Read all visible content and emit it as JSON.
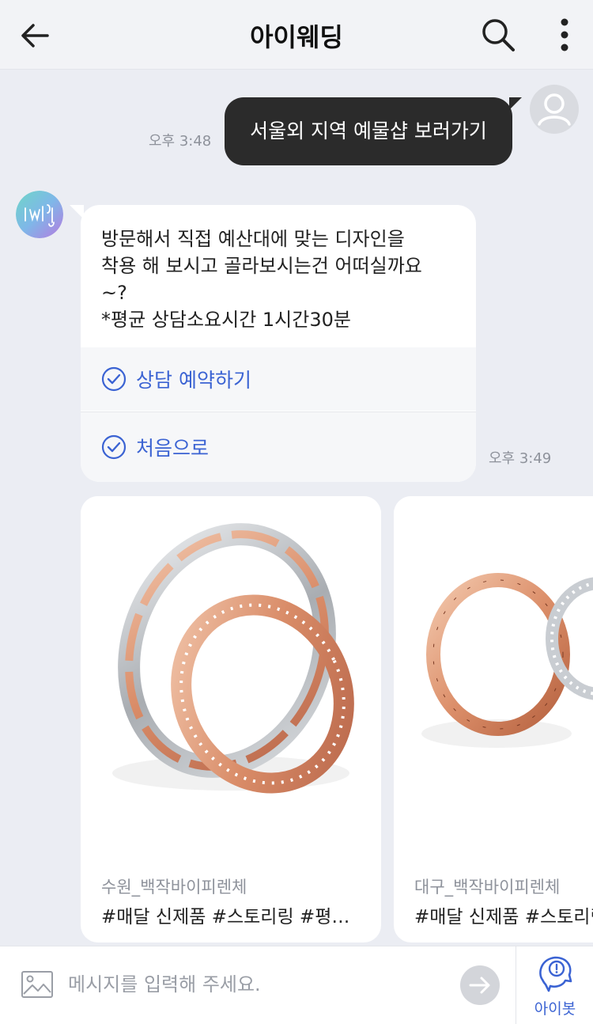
{
  "header": {
    "title": "아이웨딩",
    "back_icon": "arrow-left-icon",
    "search_icon": "search-icon",
    "more_icon": "more-vertical-icon"
  },
  "messages": {
    "user": {
      "text": "서울외 지역 예물샵 보러가기",
      "time": "오후 3:48"
    },
    "bot": {
      "lines": [
        "방문해서 직접 예산대에 맞는 디자인을",
        "착용 해 보시고 골라보시는건 어떠실까요",
        "~?",
        "*평균 상담소요시간 1시간30분"
      ],
      "buttons": [
        {
          "label": "상담 예약하기"
        },
        {
          "label": "처음으로"
        }
      ],
      "time": "오후 3:49"
    }
  },
  "products": [
    {
      "subtitle": "수원_백작바이피렌체",
      "title": "#매달 신제품 #스토리링 #평…"
    },
    {
      "subtitle": "대구_백작바이피렌체",
      "title": "#매달 신제품 #스토리링"
    }
  ],
  "input": {
    "placeholder": "메시지를 입력해 주세요.",
    "aibot_label": "아이봇"
  },
  "colors": {
    "accent": "#3b63d3",
    "user_bubble": "#2b2b2b",
    "background": "#ebedf3"
  }
}
